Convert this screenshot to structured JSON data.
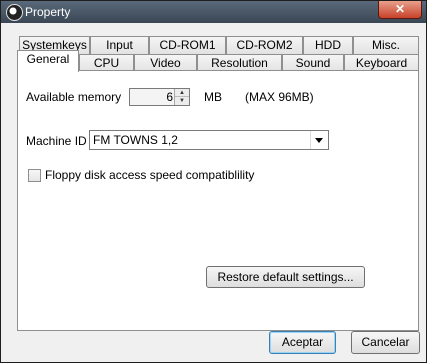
{
  "window": {
    "title": "Property",
    "close_glyph": "✕"
  },
  "tabs_row1": [
    "Systemkeys",
    "Input",
    "CD-ROM1",
    "CD-ROM2",
    "HDD",
    "Misc."
  ],
  "tabs_row2": [
    "General",
    "CPU",
    "Video",
    "Resolution",
    "Sound",
    "Keyboard"
  ],
  "active_tab": "General",
  "memory": {
    "label": "Available memory",
    "value": "6",
    "unit": "MB",
    "max_note": "(MAX 96MB)"
  },
  "machine": {
    "label": "Machine ID",
    "value": "FM TOWNS 1,2"
  },
  "floppy": {
    "label": "Floppy disk access speed compatiblility",
    "checked": false
  },
  "restore_label": "Restore default settings...",
  "ok_label": "Aceptar",
  "cancel_label": "Cancelar",
  "icons": {
    "window": "app-icon",
    "spin_up": "spin-up-icon",
    "spin_down": "spin-down-icon",
    "dropdown": "chevron-down-icon"
  }
}
